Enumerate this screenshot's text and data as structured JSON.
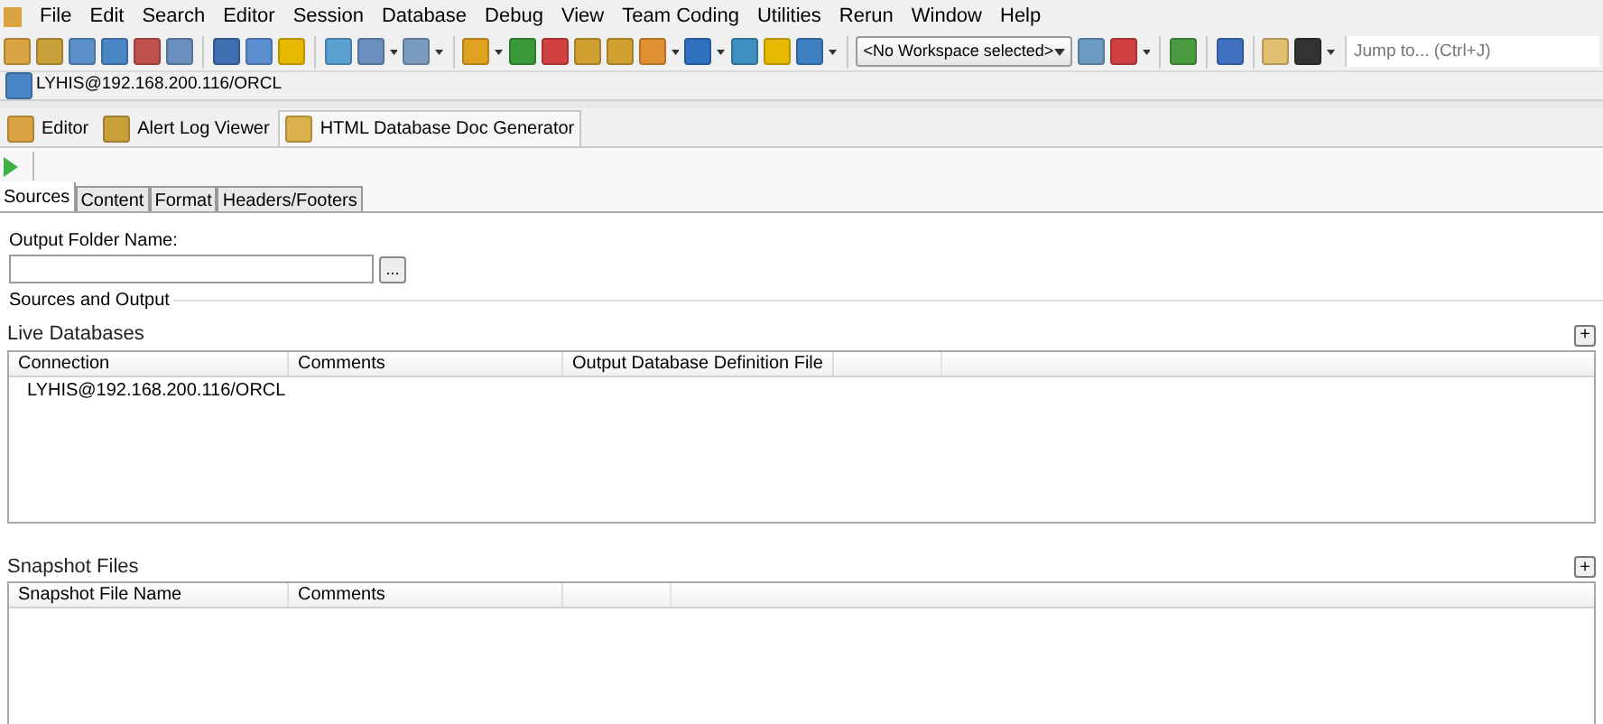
{
  "menu": [
    "File",
    "Edit",
    "Search",
    "Editor",
    "Session",
    "Database",
    "Debug",
    "View",
    "Team Coding",
    "Utilities",
    "Rerun",
    "Window",
    "Help"
  ],
  "toolbar": {
    "workspace": "<No Workspace selected>",
    "jump_placeholder": "Jump to... (Ctrl+J)"
  },
  "connection": "LYHIS@192.168.200.116/ORCL",
  "doc_tabs": [
    {
      "label": "Editor",
      "selected": false
    },
    {
      "label": "Alert Log Viewer",
      "selected": false
    },
    {
      "label": "HTML Database Doc Generator",
      "selected": true
    }
  ],
  "sub_tabs": [
    {
      "label": "Sources",
      "selected": true
    },
    {
      "label": "Content",
      "selected": false
    },
    {
      "label": "Format",
      "selected": false
    },
    {
      "label": "Headers/Footers",
      "selected": false
    }
  ],
  "output_folder": {
    "label": "Output Folder Name:",
    "browse": "..."
  },
  "group_title": "Sources and Output",
  "live": {
    "title": "Live Databases",
    "add": "+",
    "columns": [
      "Connection",
      "Comments",
      "Output Database Definition File"
    ],
    "rows": [
      [
        "LYHIS@192.168.200.116/ORCL"
      ]
    ]
  },
  "snapshot": {
    "title": "Snapshot Files",
    "add": "+",
    "columns": [
      "Snapshot File Name",
      "Comments"
    ]
  }
}
